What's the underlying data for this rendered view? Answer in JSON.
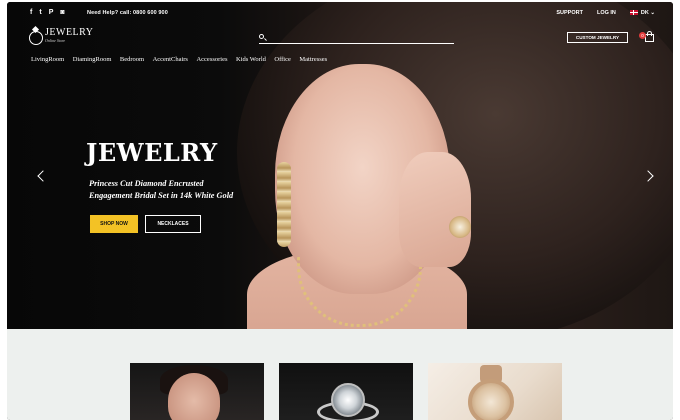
{
  "topbar": {
    "socials": [
      {
        "icon": "facebook-icon",
        "glyph": "f"
      },
      {
        "icon": "twitter-icon",
        "glyph": "t"
      },
      {
        "icon": "pinterest-icon",
        "glyph": "P"
      },
      {
        "icon": "instagram-icon",
        "glyph": "◙"
      }
    ],
    "help_text": "Need Help? call: 0800 600 900",
    "support_label": "SUPPORT",
    "login_label": "LOG IN",
    "language_label": "DK",
    "language_caret": "⌄"
  },
  "header": {
    "logo_title": "JEWELRY",
    "logo_subtitle": "Online Store",
    "custom_button_label": "CUSTOM JEWELRY",
    "cart_count": "0"
  },
  "nav": {
    "items": [
      "LivingRoom",
      "DiamingRoom",
      "Bedroom",
      "AccentChairs",
      "Accessories",
      "Kids World",
      "Office",
      "Mattresses"
    ]
  },
  "hero": {
    "title": "JEWELRY",
    "subtitle_line1": "Princess Cut Diamond Encrusted",
    "subtitle_line2": "Engagement Bridal Set in 14k White Gold",
    "primary_button_label": "SHOP NOW",
    "secondary_button_label": "NECKLACES",
    "prev_icon": "chevron-left-icon",
    "next_icon": "chevron-right-icon"
  },
  "colors": {
    "accent": "#f3c225",
    "cart_badge": "#e13b3b",
    "lower_background": "#edf0ee"
  }
}
